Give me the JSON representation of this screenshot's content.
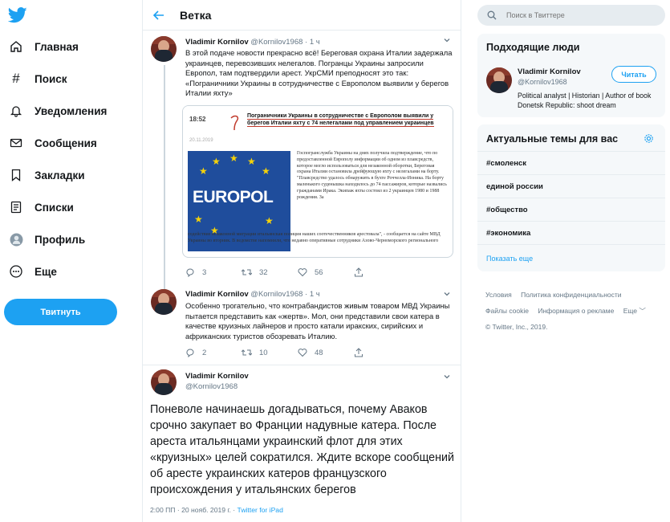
{
  "nav": {
    "items": [
      {
        "label": "Главная",
        "icon": "home-icon"
      },
      {
        "label": "Поиск",
        "icon": "hashtag-icon"
      },
      {
        "label": "Уведомления",
        "icon": "bell-icon"
      },
      {
        "label": "Сообщения",
        "icon": "envelope-icon"
      },
      {
        "label": "Закладки",
        "icon": "bookmark-icon"
      },
      {
        "label": "Списки",
        "icon": "list-icon"
      },
      {
        "label": "Профиль",
        "icon": "avatar-icon"
      },
      {
        "label": "Еще",
        "icon": "more-icon"
      }
    ],
    "tweet_button": "Твитнуть"
  },
  "header": {
    "title": "Ветка"
  },
  "tweets": [
    {
      "name": "Vladimir Kornilov",
      "handle": "@Kornilov1968",
      "time": "· 1 ч",
      "text": "В этой подаче новости прекрасно всё! Береговая охрана Италии задержала украинцев, перевозивших нелегалов. Погранцы Украины запросили Европол, там подтвердили арест. УкрСМИ преподносят это так: «Пограничники Украины в сотрудничестве с Европолом выявили у берегов Италии яхту»",
      "replies": "3",
      "retweets": "32",
      "likes": "56"
    },
    {
      "name": "Vladimir Kornilov",
      "handle": "@Kornilov1968",
      "time": "· 1 ч",
      "text": "Особенно трогательно, что контрабандистов живым товаром МВД Украины пытается представить как «жертв». Мол, они представили свои катера в качестве круизных лайнеров и просто катали иракских, сирийских и африканских туристов обозревать Италию.",
      "replies": "2",
      "retweets": "10",
      "likes": "48"
    }
  ],
  "embed": {
    "time": "18:52",
    "date": "20.11.2019",
    "headline": "Пограничники Украины в сотрудничестве с Европолом выявили у берегов Италии яхту с 74 нелегалами под управлением украинцев",
    "image_text": "EUROPOL",
    "body": "Госпогранслужба Украины на днях получила подтверждение, что по предоставленной Европолу информации об одном из плавсредств, которое могло использоваться для незаконной оборотки, Береговая охрана Италии остановила дрейфующую яхту с нелегалами на борту. \"Плавсредство удалось обнаружить в бухте Роччелла-Ионика. На борту маленького суденышка находилось до 74 пассажиров, которые назвались гражданами Ирака. Экипаж яхты состоял из 2 украинцев 1980 и 1988 рождения. За",
    "body2": "содействие незаконной миграции итальянская полиция наших соотечественников арестовала\", - сообщается на сайте МВД Украины во вторник. В ведомстве напомнили, что недавно оперативные сотрудники Азово-Черноморского регионального"
  },
  "focal": {
    "name": "Vladimir Kornilov",
    "handle": "@Kornilov1968",
    "text": "Поневоле начинаешь догадываться, почему Аваков срочно закупает во Франции надувные катера. После ареста итальянцами украинский флот для этих «круизных» целей сократился. Ждите вскоре сообщений об аресте украинских катеров французского происхождения у итальянских берегов",
    "meta": "2:00 ПП · 20 нояб. 2019 г. · ",
    "source": "Twitter for iPad"
  },
  "search": {
    "placeholder": "Поиск в Твиттере"
  },
  "people": {
    "title": "Подходящие люди",
    "name": "Vladimir Kornilov",
    "handle": "@Kornilov1968",
    "bio": "Political analyst | Historian | Author of book Donetsk Republic: shoot dream",
    "follow": "Читать"
  },
  "trends": {
    "title": "Актуальные темы для вас",
    "items": [
      "#смоленск",
      "единой россии",
      "#общество",
      "#экономика"
    ],
    "show_more": "Показать еще"
  },
  "footer": {
    "links": [
      "Условия",
      "Политика конфиденциальности",
      "Файлы cookie",
      "Информация о рекламе",
      "Еще ﹀"
    ],
    "copyright": "© Twitter, Inc., 2019."
  },
  "colors": {
    "accent": "#1da1f2",
    "text": "#14171a",
    "muted": "#657786",
    "panel": "#f5f8fa"
  }
}
